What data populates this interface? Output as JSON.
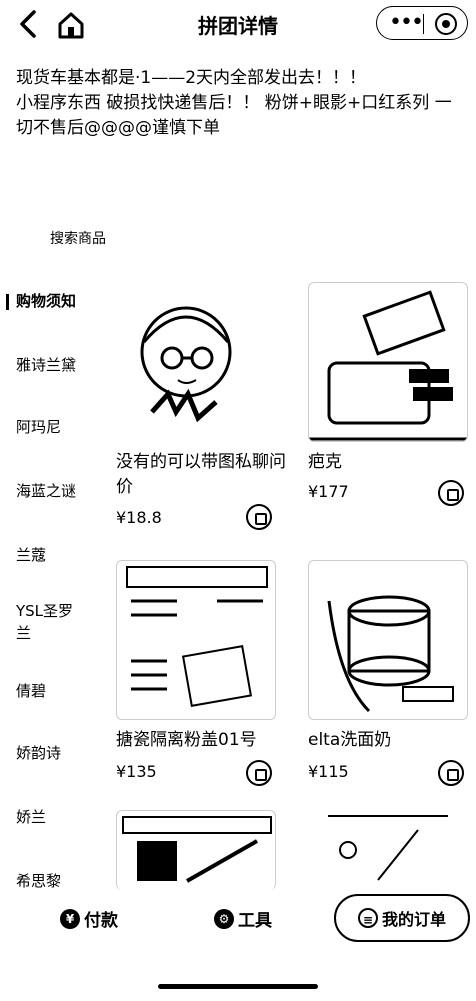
{
  "nav": {
    "back_icon": "chevron-left-icon",
    "home_icon": "home-icon",
    "title": "拼团详情",
    "more_icon": "more-dots-icon",
    "close_icon": "target-icon"
  },
  "notice": {
    "line1": "现货车基本都是·1——2天内全部发出去！！！",
    "line2": "小程序东西 破损找快递售后！！ 粉饼+眼影+口红系列 一切不售后@@@@谨慎下单"
  },
  "search": {
    "placeholder": "搜索商品"
  },
  "sidebar": {
    "items": [
      {
        "label": "购物须知",
        "active": true
      },
      {
        "label": "雅诗兰黛"
      },
      {
        "label": "阿玛尼"
      },
      {
        "label": "海蓝之谜"
      },
      {
        "label": "兰蔻"
      },
      {
        "label": "YSL圣罗兰"
      },
      {
        "label": "倩碧"
      },
      {
        "label": "娇韵诗"
      },
      {
        "label": "娇兰"
      },
      {
        "label": "希思黎"
      }
    ]
  },
  "products": [
    {
      "name": "没有的可以带图私聊问价",
      "price": "¥18.8"
    },
    {
      "name": "疤克",
      "price": "¥177"
    },
    {
      "name": "搪瓷隔离粉盖01号",
      "price": "¥135"
    },
    {
      "name": "elta洗面奶",
      "price": "¥115"
    }
  ],
  "bottom": {
    "pay_label": "付款",
    "tools_label": "工具",
    "orders_label": "我的订单"
  },
  "colors": {
    "text": "#000000",
    "background": "#ffffff",
    "border": "#cccccc"
  }
}
